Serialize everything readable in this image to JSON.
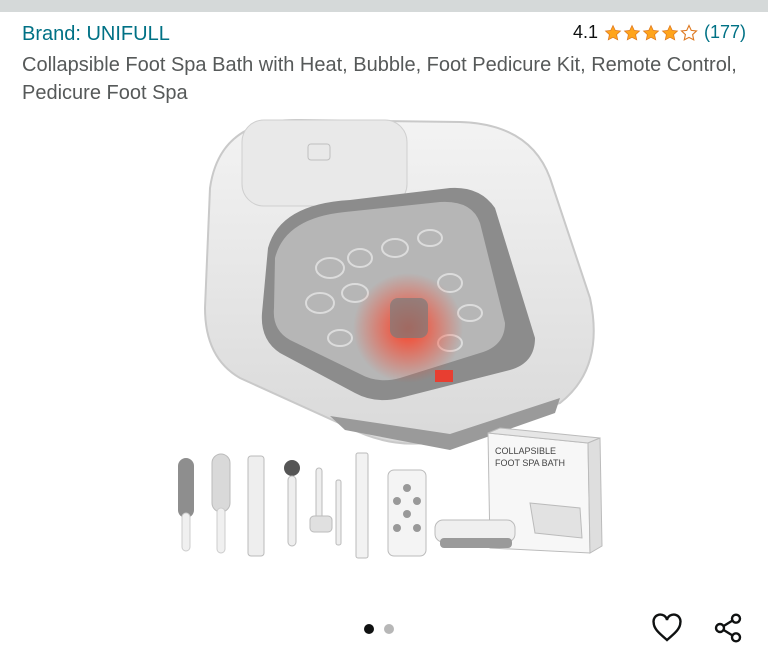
{
  "header": {
    "brand_label": "Brand: UNIFULL",
    "rating_value": "4.1",
    "rating_stars": 4.1,
    "review_count": "(177)",
    "title": "Collapsible Foot Spa Bath with Heat, Bubble, Foot Pedicure Kit, Remote Control, Pedicure Foot Spa"
  },
  "image": {
    "box_text_line1": "COLLAPSIBLE",
    "box_text_line2": "FOOT SPA BATH",
    "remote_display": "—"
  },
  "gallery": {
    "total": 2,
    "current": 1
  },
  "actions": {
    "wishlist_icon": "heart-outline-icon",
    "share_icon": "share-icon"
  },
  "colors": {
    "link": "#007185",
    "star": "#ffa41c",
    "text": "#0f1111",
    "muted": "#565959"
  }
}
